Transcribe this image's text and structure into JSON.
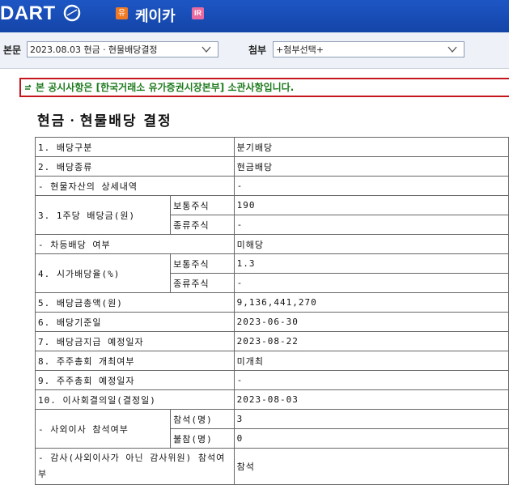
{
  "header": {
    "logo_text": "DART",
    "badge_left": "유",
    "company_name": "케이카",
    "badge_right": "IR",
    "bg_color": "#1a4fb8"
  },
  "subbar": {
    "main_label": "본문",
    "main_select_value": "2023.08.03  현금ㆍ현물배당결정",
    "attach_label": "첨부",
    "attach_select_value": "+첨부선택+"
  },
  "notice": {
    "text": "본 공시사항은 [한국거래소 유가증권시장본부] 소관사항입니다.",
    "border_color": "#c4161c",
    "text_color": "#1d7a1d"
  },
  "page_title": "현금ㆍ현물배당 결정",
  "table": {
    "r1": {
      "label": "1. 배당구분",
      "value": "분기배당"
    },
    "r2": {
      "label": "2. 배당종류",
      "value": "현금배당"
    },
    "r3": {
      "label": "- 현물자산의 상세내역",
      "value": "-"
    },
    "r4": {
      "label": "3. 1주당 배당금(원)",
      "sub1": "보통주식",
      "val1": "190",
      "sub2": "종류주식",
      "val2": "-"
    },
    "r5": {
      "label": "- 차등배당 여부",
      "value": "미해당"
    },
    "r6": {
      "label": "4. 시가배당율(%)",
      "sub1": "보통주식",
      "val1": "1.3",
      "sub2": "종류주식",
      "val2": "-"
    },
    "r7": {
      "label": "5. 배당금총액(원)",
      "value": "9,136,441,270"
    },
    "r8": {
      "label": "6. 배당기준일",
      "value": "2023-06-30"
    },
    "r9": {
      "label": "7. 배당금지급 예정일자",
      "value": "2023-08-22"
    },
    "r10": {
      "label": "8. 주주총회 개최여부",
      "value": "미개최"
    },
    "r11": {
      "label": "9. 주주총회 예정일자",
      "value": "-"
    },
    "r12": {
      "label": "10. 이사회결의일(결정일)",
      "value": "2023-08-03"
    },
    "r13": {
      "label": "- 사외이사 참석여부",
      "sub1": "참석(명)",
      "val1": "3",
      "sub2": "불참(명)",
      "val2": "0"
    },
    "r14": {
      "label": "- 감사(사외이사가 아닌 감사위원) 참석여부",
      "value": "참석"
    }
  }
}
